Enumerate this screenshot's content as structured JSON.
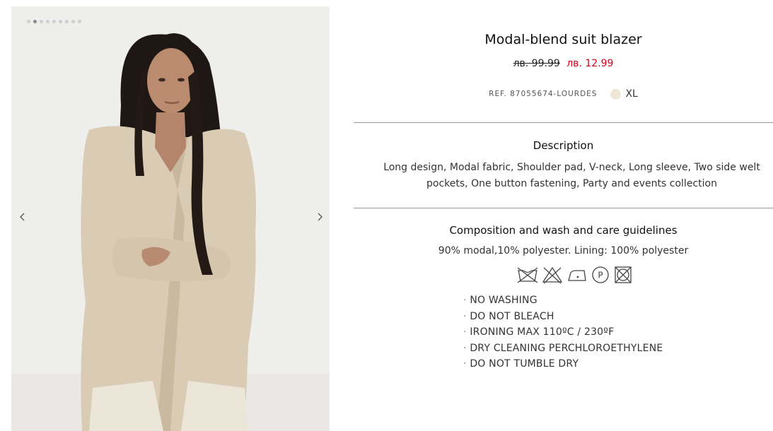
{
  "product": {
    "title": "Modal-blend suit blazer",
    "price_old": "лв. 99.99",
    "price_new": "лв. 12.99",
    "reference": "REF. 87055674-LOURDES",
    "size": "XL"
  },
  "colors": {
    "sale_price": "#d0021b",
    "swatch": "#efe6d8"
  },
  "gallery": {
    "image_alt": "Model wearing beige modal-blend suit blazer",
    "total_images": 9,
    "active_index": 1,
    "prev_icon": "chevron-left-icon",
    "next_icon": "chevron-right-icon"
  },
  "description": {
    "heading": "Description",
    "lines": [
      "Long design, Modal fabric, Shoulder pad, V-neck, Long sleeve, Two side welt",
      "pockets, One button fastening, Party and events collection"
    ]
  },
  "care": {
    "heading": "Composition and wash and care guidelines",
    "composition": "90% modal,10% polyester. Lining: 100% polyester",
    "icons": [
      "no-washing-icon",
      "no-bleach-icon",
      "iron-medium-icon",
      "dry-clean-p-icon",
      "no-tumble-dry-icon"
    ],
    "instructions": [
      "NO WASHING",
      "DO NOT BLEACH",
      "IRONING MAX 110ºC / 230ºF",
      "DRY CLEANING PERCHLOROETHYLENE",
      "DO NOT TUMBLE DRY"
    ]
  }
}
